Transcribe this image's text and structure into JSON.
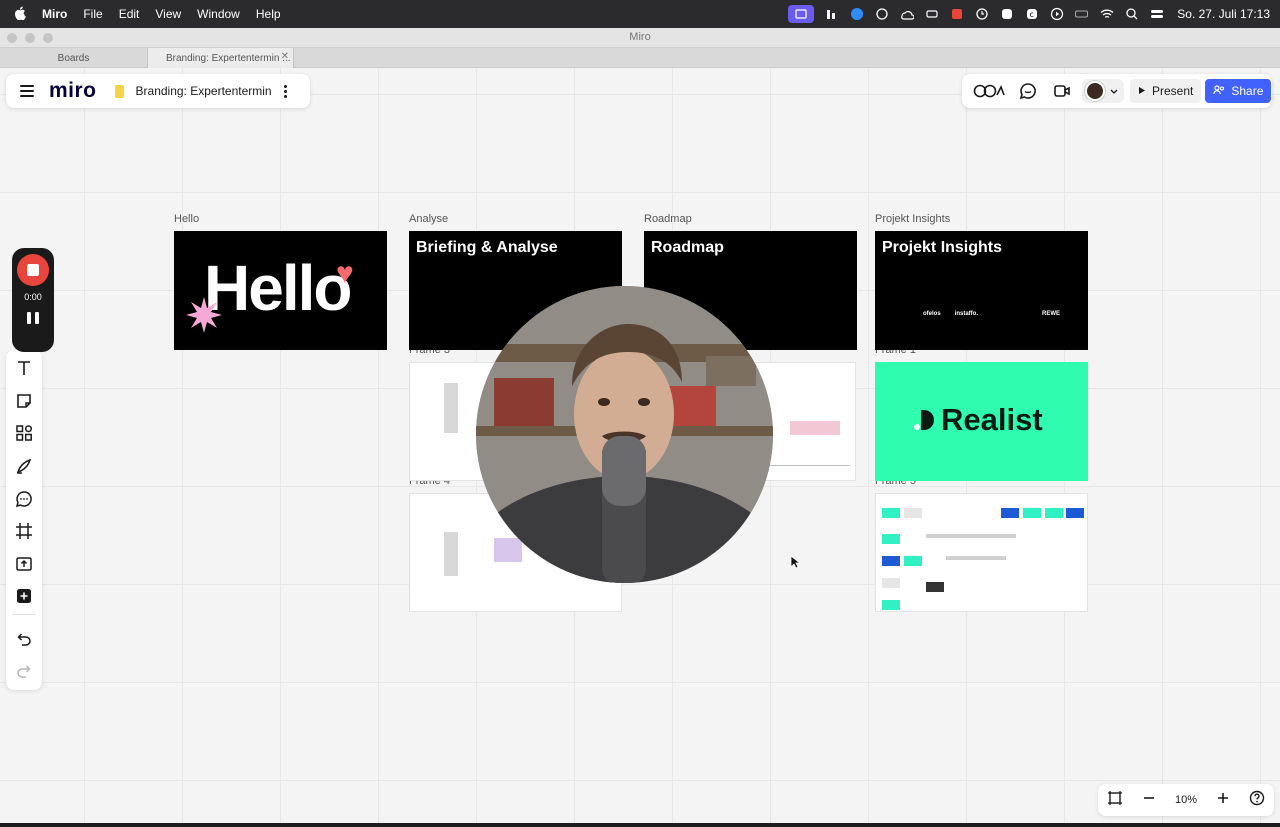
{
  "menubar": {
    "app_name": "Miro",
    "menus": [
      "File",
      "Edit",
      "View",
      "Window",
      "Help"
    ],
    "clock": "So. 27. Juli  17:13"
  },
  "window": {
    "title": "Miro"
  },
  "tabs": [
    {
      "label": "Boards"
    },
    {
      "label": "Branding: Expertentermin ..."
    }
  ],
  "header": {
    "logo": "miro",
    "board_title": "Branding: Expertentermin",
    "present_label": "Present",
    "share_label": "Share"
  },
  "recorder": {
    "time": "0:00"
  },
  "zoom": {
    "level": "10%"
  },
  "frames": {
    "hello": {
      "label": "Hello",
      "text": "Hello"
    },
    "analyse": {
      "label": "Analyse",
      "title": "Briefing & Analyse"
    },
    "roadmap": {
      "label": "Roadmap",
      "title": "Roadmap"
    },
    "insights": {
      "label": "Projekt Insights",
      "title": "Projekt Insights",
      "logos": [
        "ofelos",
        "instaffo.",
        "REWE"
      ]
    },
    "frame3": {
      "label": "Frame 3"
    },
    "frame1": {
      "label": "Frame 1",
      "brand": "Realist"
    },
    "frame4": {
      "label": "Frame 4"
    },
    "frame5": {
      "label": "Frame 5"
    }
  },
  "colors": {
    "accent": "#4262ff",
    "record": "#e8453c",
    "realist_green": "#2ffcae"
  }
}
